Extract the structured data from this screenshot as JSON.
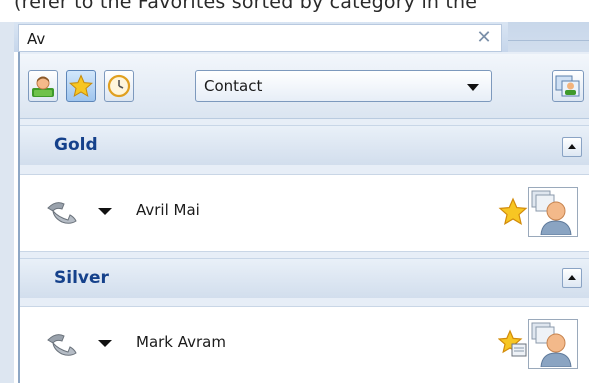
{
  "caption_text": "(refer to the Favorites sorted by category in the",
  "search": {
    "value": "Av"
  },
  "toolbar": {
    "dropdown_value": "Contact"
  },
  "groups": [
    {
      "title": "Gold",
      "contacts": [
        {
          "name": "Avril Mai"
        }
      ]
    },
    {
      "title": "Silver",
      "contacts": [
        {
          "name": "Mark Avram"
        }
      ]
    }
  ],
  "colors": {
    "group_title": "#15418b",
    "panel_bg": "#e7eef7",
    "star": "#f6c21a"
  }
}
